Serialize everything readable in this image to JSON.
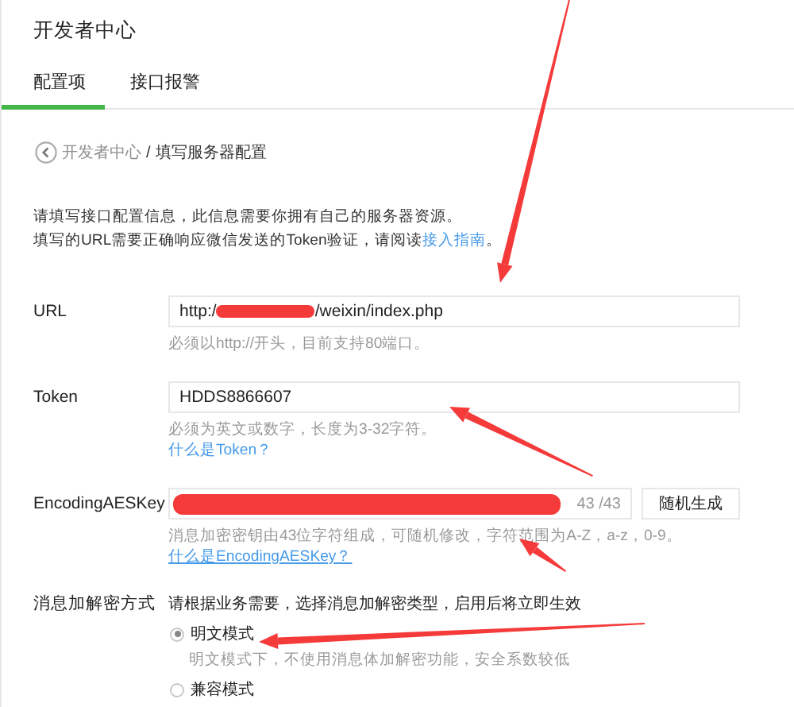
{
  "header": {
    "title": "开发者中心"
  },
  "tabs": [
    {
      "label": "配置项",
      "selected": true
    },
    {
      "label": "接口报警",
      "selected": false
    }
  ],
  "breadcrumb": {
    "parent": "开发者中心",
    "separator": "/",
    "current": "填写服务器配置"
  },
  "intro": {
    "line_1": "请填写接口配置信息，此信息需要你拥有自己的服务器资源。",
    "line_2_text": "填写的URL需要正确响应微信发送的Token验证，请阅读",
    "line_2_link": "接入指南",
    "line_2_end": "。"
  },
  "fields": [
    {
      "kind": "text",
      "label": "URL",
      "value_before": "http:/",
      "redacted": true,
      "value_after": "/weixin/index.php",
      "hint": "必须以http://开头，目前支持80端口。"
    },
    {
      "kind": "text",
      "label": "Token",
      "value": "HDDS8866607",
      "hint": "必须为英文或数字，长度为3-32字符。",
      "help_link": "什么是Token？"
    },
    {
      "kind": "key",
      "label": "EncodingAESKey",
      "redacted": true,
      "counter": "43 /43",
      "button": "随机生成",
      "hint": "消息加密密钥由43位字符组成，可随机修改，字符范围为A-Z，a-z，0-9。",
      "help_link": "什么是EncodingAESKey？"
    },
    {
      "kind": "radio",
      "label": "消息加解密方式",
      "description": "请根据业务需要，选择消息加解密类型，启用后将立即生效",
      "options": [
        {
          "label": "明文模式",
          "selected": true,
          "hint": "明文模式下，不使用消息体加解密功能，安全系数较低"
        },
        {
          "label": "兼容模式",
          "selected": false
        }
      ]
    }
  ],
  "annotations": [
    {
      "kind": "arrow"
    },
    {
      "kind": "arrow"
    },
    {
      "kind": "arrow"
    },
    {
      "kind": "arrow"
    }
  ]
}
